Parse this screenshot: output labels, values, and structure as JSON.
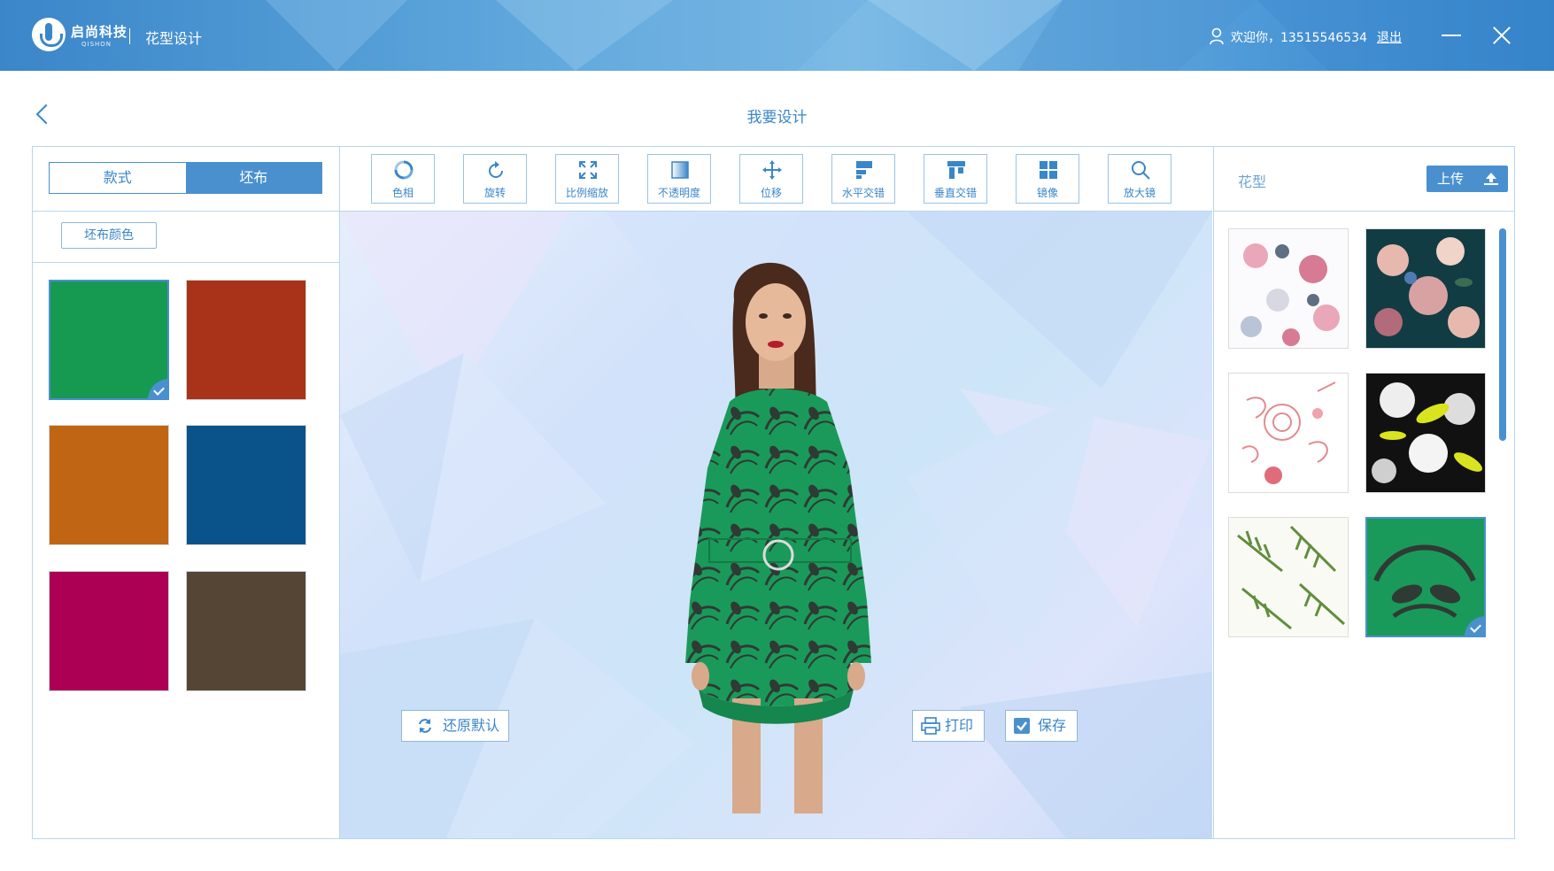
{
  "titlebar": {
    "brand": "启尚科技",
    "brand_sub": "QISHON",
    "app_title": "花型设计",
    "welcome_text": "欢迎你，13515546534",
    "logout_label": "退出"
  },
  "page": {
    "title": "我要设计"
  },
  "left_panel": {
    "tabs": [
      {
        "label": "款式",
        "active": false
      },
      {
        "label": "坯布",
        "active": true
      }
    ],
    "sub_button": "坯布颜色",
    "swatches": [
      {
        "color": "#169a52",
        "selected": true
      },
      {
        "color": "#a83319",
        "selected": false
      },
      {
        "color": "#bf6513",
        "selected": false
      },
      {
        "color": "#0a538a",
        "selected": false
      },
      {
        "color": "#ab0053",
        "selected": false
      },
      {
        "color": "#544535",
        "selected": false
      }
    ]
  },
  "toolbar": {
    "tools": [
      {
        "label": "色相",
        "icon": "hue-icon"
      },
      {
        "label": "旋转",
        "icon": "rotate-icon"
      },
      {
        "label": "比例缩放",
        "icon": "scale-icon"
      },
      {
        "label": "不透明度",
        "icon": "opacity-icon"
      },
      {
        "label": "位移",
        "icon": "move-icon"
      },
      {
        "label": "水平交错",
        "icon": "horizontal-stagger-icon"
      },
      {
        "label": "垂直交错",
        "icon": "vertical-stagger-icon"
      },
      {
        "label": "镜像",
        "icon": "mirror-icon"
      },
      {
        "label": "放大镜",
        "icon": "magnifier-icon"
      }
    ]
  },
  "canvas": {
    "reset_label": "还原默认",
    "print_label": "打印",
    "save_label": "保存"
  },
  "right_panel": {
    "label": "花型",
    "upload_label": "上传",
    "patterns": [
      {
        "name": "pink-floral-white",
        "selected": false
      },
      {
        "name": "roses-dark-teal",
        "selected": false
      },
      {
        "name": "pink-line-floral",
        "selected": false
      },
      {
        "name": "yellow-black-floral",
        "selected": false
      },
      {
        "name": "green-palm-leaves",
        "selected": false
      },
      {
        "name": "green-leaf-stripe",
        "selected": true
      }
    ]
  },
  "colors": {
    "accent": "#4a90cf",
    "accent_text": "#3a86c8",
    "border": "#b9d5ee"
  }
}
